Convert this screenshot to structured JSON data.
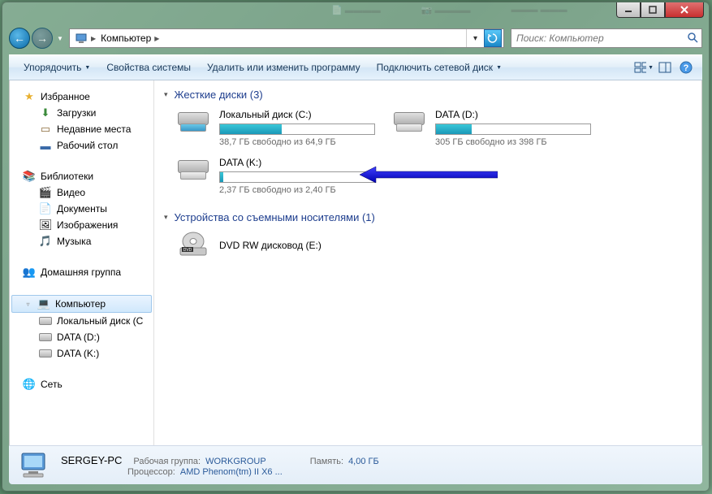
{
  "breadcrumb": {
    "location": "Компьютер"
  },
  "search": {
    "placeholder": "Поиск: Компьютер"
  },
  "toolbar": {
    "organize": "Упорядочить",
    "props": "Свойства системы",
    "uninstall": "Удалить или изменить программу",
    "netdrive": "Подключить сетевой диск"
  },
  "sidebar": {
    "fav": {
      "title": "Избранное",
      "items": [
        "Загрузки",
        "Недавние места",
        "Рабочий стол"
      ]
    },
    "lib": {
      "title": "Библиотеки",
      "items": [
        "Видео",
        "Документы",
        "Изображения",
        "Музыка"
      ]
    },
    "home": {
      "title": "Домашняя группа"
    },
    "comp": {
      "title": "Компьютер",
      "items": [
        "Локальный диск (C",
        "DATA (D:)",
        "DATA (K:)"
      ]
    },
    "net": {
      "title": "Сеть"
    }
  },
  "groups": {
    "hdd": {
      "title": "Жесткие диски (3)"
    },
    "removable": {
      "title": "Устройства со съемными носителями (1)"
    }
  },
  "drives": {
    "c": {
      "name": "Локальный диск (C:)",
      "info": "38,7 ГБ свободно из 64,9 ГБ",
      "pct": 40
    },
    "d": {
      "name": "DATA (D:)",
      "info": "305 ГБ свободно из 398 ГБ",
      "pct": 23
    },
    "k": {
      "name": "DATA (K:)",
      "info": "2,37 ГБ свободно из 2,40 ГБ",
      "pct": 2
    },
    "e": {
      "name": "DVD RW дисковод (E:)"
    }
  },
  "status": {
    "name": "SERGEY-PC",
    "wg_lbl": "Рабочая группа:",
    "wg": "WORKGROUP",
    "mem_lbl": "Память:",
    "mem": "4,00 ГБ",
    "cpu_lbl": "Процессор:",
    "cpu": "AMD Phenom(tm) II X6 ..."
  }
}
